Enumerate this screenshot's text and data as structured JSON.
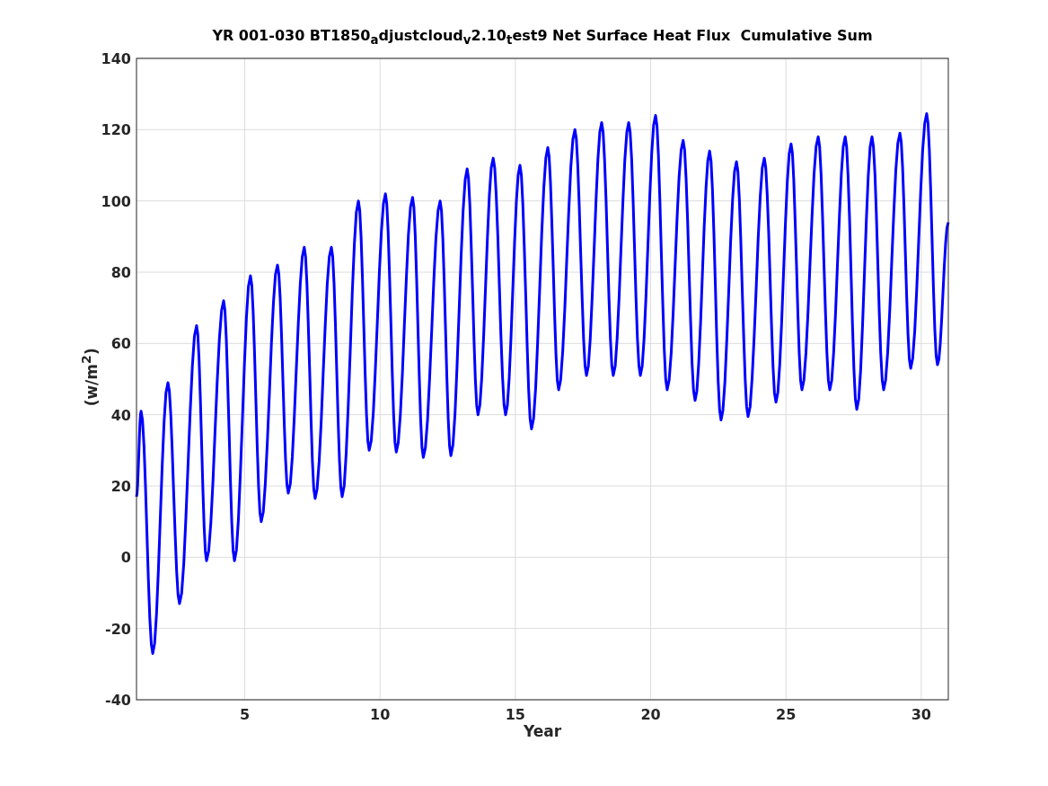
{
  "figure": {
    "chart_data": {
      "type": "line",
      "title": "YR 001-030 BT1850$_{a}$djustcloud$_{v}$2.10$_{t}$est9 Net Surface Heat Flux  Cumulative Sum",
      "xlabel": "Year",
      "ylabel": "(w/m$^{2}$)",
      "xlim": [
        1,
        31
      ],
      "ylim": [
        -40,
        140
      ],
      "xticks": [
        5,
        10,
        15,
        20,
        25,
        30
      ],
      "yticks": [
        -40,
        -20,
        0,
        20,
        40,
        60,
        80,
        100,
        120,
        140
      ],
      "grid": true,
      "x": [
        1,
        1.17,
        1.6,
        2.16,
        2.59,
        3.22,
        3.59,
        4.22,
        4.62,
        5.21,
        5.61,
        6.21,
        6.61,
        7.2,
        7.6,
        8.2,
        8.6,
        9.2,
        9.6,
        10.2,
        10.6,
        11.2,
        11.6,
        12.22,
        12.62,
        13.22,
        13.62,
        14.18,
        14.64,
        15.17,
        15.6,
        16.2,
        16.6,
        17.2,
        17.63,
        18.19,
        18.62,
        19.19,
        19.62,
        20.18,
        20.61,
        21.2,
        21.64,
        22.18,
        22.6,
        23.17,
        23.6,
        24.2,
        24.63,
        25.19,
        25.59,
        26.19,
        26.62,
        27.19,
        27.62,
        28.18,
        28.61,
        29.21,
        29.61,
        30.2,
        30.6,
        31
      ],
      "series": [
        {
          "color": "#0000ff",
          "values": [
            17,
            41,
            -27,
            49,
            -13,
            65,
            -1,
            72,
            -1,
            79,
            10,
            82,
            18,
            87,
            16.5,
            87,
            17,
            100,
            30,
            102,
            29.5,
            101,
            28,
            100,
            28.5,
            109,
            40,
            112,
            40,
            110,
            36,
            115,
            47,
            120,
            51,
            122,
            51,
            122,
            51,
            124,
            47,
            117,
            44,
            114,
            38.5,
            111,
            39.5,
            112,
            43.5,
            116,
            47,
            118,
            47,
            118,
            41.5,
            118,
            47,
            119,
            53,
            124.5,
            54,
            94
          ]
        }
      ]
    }
  }
}
